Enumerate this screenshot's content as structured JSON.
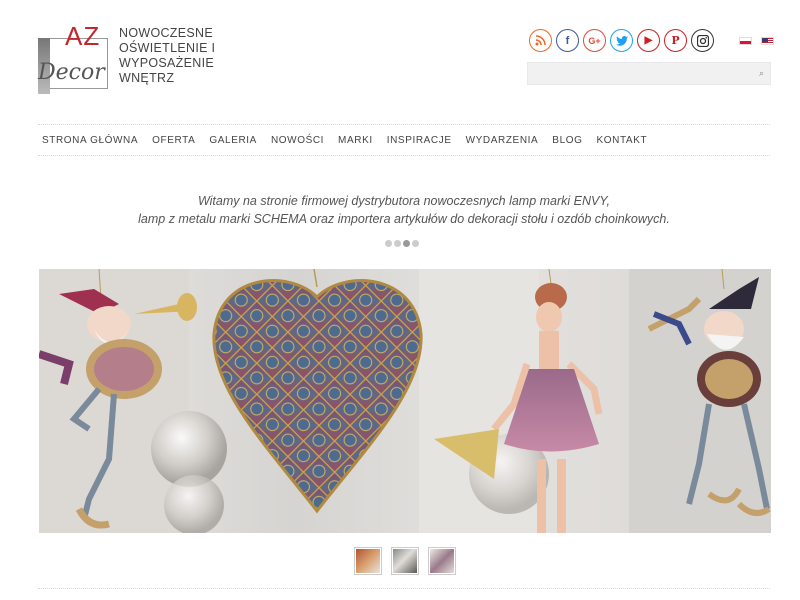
{
  "logo": {
    "az": "AZ",
    "decor": "Decor"
  },
  "tagline": {
    "line1": "NOWOCZESNE",
    "line2": "OŚWIETLENIE I",
    "line3": "WYPOSAŻENIE",
    "line4": "WNĘTRZ"
  },
  "social": [
    {
      "icon": "rss-icon",
      "glyph": "☊",
      "color": "#f26522"
    },
    {
      "icon": "facebook-icon",
      "glyph": "f",
      "color": "#3b5998"
    },
    {
      "icon": "google-plus-icon",
      "glyph": "G+",
      "color": "#dd4b39"
    },
    {
      "icon": "twitter-icon",
      "glyph": "t",
      "color": "#1da1f2"
    },
    {
      "icon": "youtube-icon",
      "glyph": "▶",
      "color": "#cd201f"
    },
    {
      "icon": "pinterest-icon",
      "glyph": "P",
      "color": "#cb2027"
    },
    {
      "icon": "instagram-icon",
      "glyph": "◙",
      "color": "#333333"
    }
  ],
  "flags": {
    "pl": "pl-flag-icon",
    "en": "en-flag-icon"
  },
  "search": {
    "placeholder": "",
    "value": ""
  },
  "nav": [
    "STRONA GŁÓWNA",
    "OFERTA",
    "GALERIA",
    "NOWOŚCI",
    "MARKI",
    "INSPIRACJE",
    "WYDARZENIA",
    "BLOG",
    "KONTAKT"
  ],
  "intro": {
    "line1": "Witamy na stronie firmowej dystrybutora nowoczesnych lamp marki ENVY,",
    "line2": "lamp z metalu marki SCHEMA oraz importera artykułów do dekoracji stołu i ozdób choinkowych."
  },
  "slider": {
    "dots": 4,
    "active_dot": 2,
    "thumbnails": 3
  }
}
